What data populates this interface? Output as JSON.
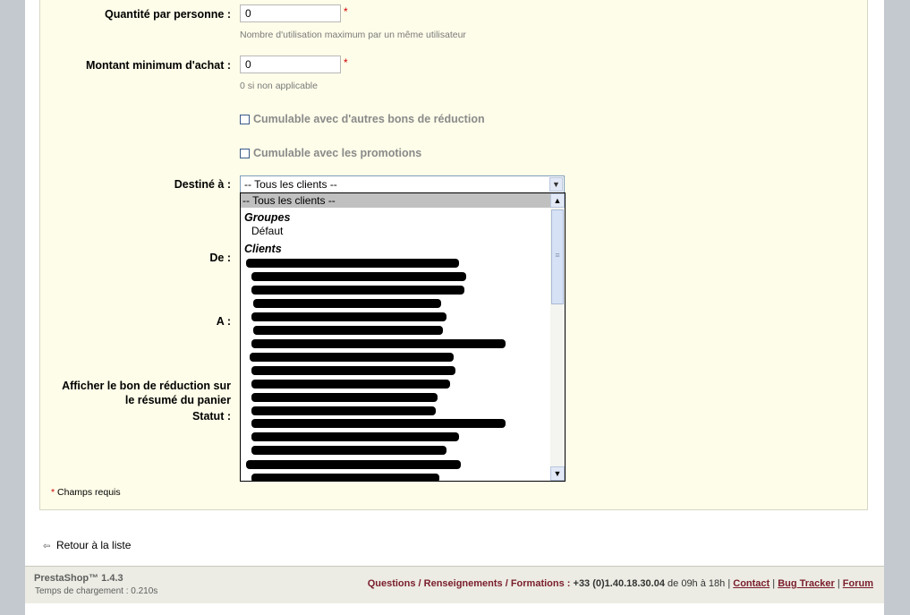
{
  "form": {
    "quantity_label": "Quantité par personne :",
    "quantity_value": "0",
    "quantity_hint": "Nombre d'utilisation maximum par un même utilisateur",
    "minimum_label": "Montant minimum d'achat :",
    "minimum_value": "0",
    "minimum_hint": "0 si non applicable",
    "required_star": "*",
    "cumul_vouchers_label": "Cumulable avec d'autres bons de réduction",
    "cumul_promos_label": "Cumulable avec les promotions",
    "destine_label": "Destiné à :",
    "destine_selected": "-- Tous les clients --",
    "from_label": "De :",
    "to_label": "A :",
    "display_label_1": "Afficher le bon de réduction sur",
    "display_label_2": "le résumé du panier",
    "status_label": "Statut :",
    "required_legend": "Champs requis"
  },
  "dropdown": {
    "selected_option": "-- Tous les clients --",
    "group_header_groups": "Groupes",
    "group_default": "Défaut",
    "group_header_clients": "Clients",
    "redacted_client_rows": 17
  },
  "nav": {
    "back_label": "Retour à la liste"
  },
  "footer": {
    "brand": "PrestaShop™ 1.4.3",
    "load_time": "Temps de chargement : 0.210s",
    "questions": "Questions / Renseignements / Formations :",
    "phone": "+33 (0)1.40.18.30.04",
    "hours": "de 09h à 18h |",
    "contact": "Contact",
    "bug_tracker": "Bug Tracker",
    "forum": "Forum",
    "sep": "|"
  },
  "icons": {
    "back": "back-arrow-icon",
    "dropdown": "chevron-down-icon",
    "scroll_up": "scroll-up-icon",
    "scroll_down": "scroll-down-icon"
  },
  "colors": {
    "panel_bg": "#fefde9",
    "required": "#cc0000",
    "footer_link": "#7a1d2b",
    "selected_option_bg": "#c0c0c0"
  }
}
